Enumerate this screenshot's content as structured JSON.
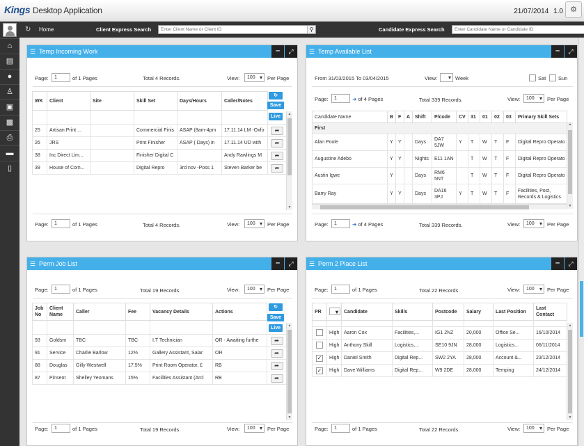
{
  "app": {
    "brand": "Kings",
    "subtitle": "Desktop Application",
    "date": "21/07/2014",
    "version": "1.0"
  },
  "nav": {
    "home": "Home",
    "client_search_label": "Client Express Search",
    "client_search_placeholder": "Enter Client Name or Client ID",
    "candidate_search_label": "Candidate Express Search",
    "candidate_search_placeholder": "Enter Candidate Name or Candidate ID"
  },
  "sidebar": {
    "icons": [
      "home-icon",
      "chart-icon",
      "user-icon",
      "person-icon",
      "briefcase-icon",
      "book-icon",
      "printer-icon",
      "folder-icon",
      "folder-open-icon"
    ]
  },
  "colors": {
    "header_blue": "#44b0e9",
    "link": "#2a6cc0",
    "dark": "#333333"
  },
  "p1": {
    "title": "Temp Incoming Work",
    "page_label": "Page:",
    "page": "1",
    "pages_text": "of 1 Pages",
    "total": "Total 4 Records.",
    "view_label": "View:",
    "view": "100",
    "per_page": "Per Page",
    "cols": [
      "WK",
      "Client",
      "Site",
      "Skill Set",
      "Days/Hours",
      "Caller/Notes"
    ],
    "btn_save": "Save",
    "btn_live": "Live",
    "rows": [
      [
        "25",
        "Artisan Print ...",
        "",
        "Commercial Finis",
        "ASAP (8am-4pm",
        "17.11.14 LM -Oxfo"
      ],
      [
        "26",
        "JRS",
        "",
        "Print Finisher",
        "ASAP ( Days) in",
        "17.11.14 UD with"
      ],
      [
        "38",
        "Inc Direct Lim...",
        "",
        "Finisher Digital C",
        "",
        "Andy Rawlings M"
      ],
      [
        "39",
        "House of Com...",
        "",
        "Digital Repro",
        "3rd nov  -Poss 1",
        "Steven Barker be"
      ]
    ]
  },
  "p2": {
    "title": "Temp Available List",
    "range": "From 31/03/2015 To 03/04/2015",
    "view_label": "View:",
    "week": "Week",
    "sat": "Sat",
    "sun": "Sun",
    "page_label": "Page:",
    "page": "1",
    "pages_text": "of 4 Pages",
    "total": "Total 339 Records.",
    "view": "100",
    "per_page": "Per Page",
    "cols": [
      "Candidate Name",
      "B",
      "F",
      "A",
      "Shift",
      "P/code",
      "CV",
      "31",
      "01",
      "02",
      "03",
      "Primary Skill Sets"
    ],
    "group": "First",
    "rows": [
      [
        "Alan Poole",
        "Y",
        "Y",
        "",
        "Days",
        "DA7 5JW",
        "Y",
        "T",
        "W",
        "T",
        "F",
        "Digital Repro Operato"
      ],
      [
        "Augustine Adebo",
        "Y",
        "Y",
        "",
        "Nights",
        "E11 1AN",
        "",
        "T",
        "W",
        "T",
        "F",
        "Digital Repro Operato"
      ],
      [
        "Austin Igwe",
        "Y",
        "",
        "",
        "Days",
        "RM6 5NT",
        "",
        "T",
        "W",
        "T",
        "F",
        "Digital Repro Operato"
      ],
      [
        "Barry Ray",
        "Y",
        "Y",
        "",
        "Days",
        "DA16 3PJ",
        "Y",
        "T",
        "W",
        "T",
        "F",
        "Facilities, Post, Records & Logistics"
      ]
    ]
  },
  "p3": {
    "title": "Perm Job List",
    "page_label": "Page:",
    "page": "1",
    "pages_text": "of 1 Pages",
    "total": "Total 19 Records.",
    "view_label": "View:",
    "view": "100",
    "per_page": "Per Page",
    "cols": [
      "Job No",
      "Client Name",
      "Caller",
      "Fee",
      "Vacancy Details",
      "Actions"
    ],
    "btn_save": "Save",
    "btn_live": "Live",
    "rows": [
      [
        "93",
        "Goldsm",
        "TBC",
        "TBC",
        "I.T Technician",
        "OR - Awaiting furthe"
      ],
      [
        "91",
        "Service",
        "Charlie Barlow",
        "12%",
        "Gallery Assistant, Salar",
        "OR"
      ],
      [
        "88",
        "Douglas",
        "Gilly Westwell",
        "17.5%",
        "Print Room Operator, £",
        "RB"
      ],
      [
        "87",
        "Pinsent",
        "Shelley Yeomans",
        "15%",
        "Facilities Assistant (Arcl",
        "RB"
      ]
    ]
  },
  "p4": {
    "title": "Perm 2 Place List",
    "page_label": "Page:",
    "page": "1",
    "pages_text": "of 1 Pages",
    "total": "Total 22 Records.",
    "view_label": "View:",
    "view": "100",
    "per_page": "Per Page",
    "cols": [
      "PR",
      "",
      "Candidate",
      "Skills",
      "Postcode",
      "Salary",
      "Last Position",
      "Last Contact"
    ],
    "rows": [
      [
        "",
        "High",
        "Aaron Cox",
        "Facilities,...",
        "IG1 2NZ",
        "20,000",
        "Office Se...",
        "16/10/2014"
      ],
      [
        "",
        "High",
        "Anthony Skill",
        "Logistics,...",
        "SE10 9JN",
        "28,000",
        "Logistics...",
        "06/11/2014"
      ],
      [
        "✓",
        "High",
        "Daniel Smith",
        "Digital Rep...",
        "SW2 2YA",
        "28,000",
        "Account &...",
        "23/12/2014"
      ],
      [
        "✓",
        "High",
        "Dave Williams",
        "Digital Rep...",
        "W9 2DE",
        "28,000",
        "Temping",
        "24/12/2014"
      ]
    ]
  }
}
